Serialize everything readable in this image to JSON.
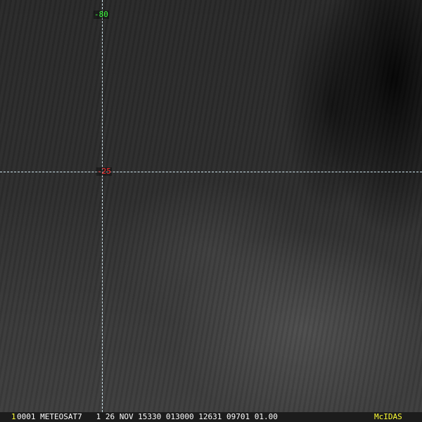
{
  "grid": {
    "longitude_label": "-80",
    "latitude_label": "-25"
  },
  "info_bar": {
    "frame": "1",
    "text": "0001 METEOSAT7   1 26 NOV 15330 013000 12631 09701 01.00",
    "brand": "McIDAS"
  },
  "colors": {
    "longitude_label": "#3cff3c",
    "latitude_label": "#ff2a2a",
    "grid": "#cfe6ee",
    "brand": "#ffff33"
  }
}
